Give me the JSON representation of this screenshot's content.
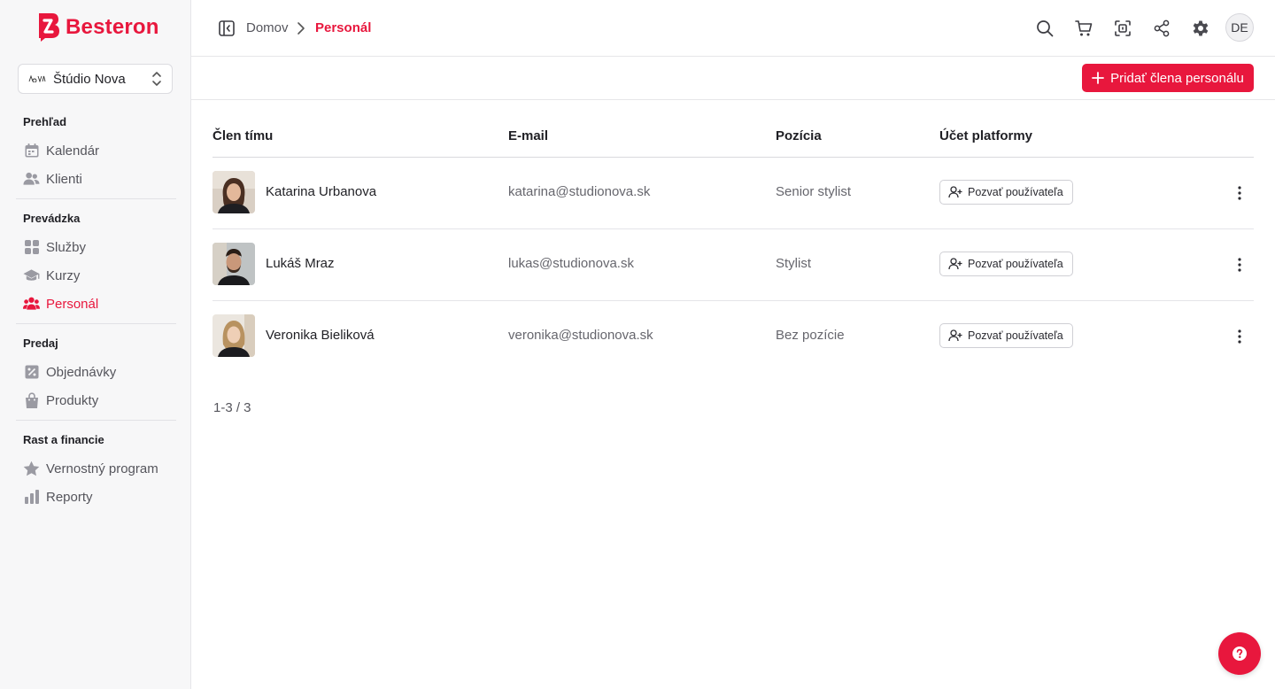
{
  "brand": {
    "name": "Besteron",
    "accent": "#e8173d"
  },
  "workspace": {
    "name": "Štúdio Nova",
    "logo_text": "NOVA"
  },
  "sidebar": {
    "sections": [
      {
        "heading": "Prehľad",
        "items": [
          {
            "label": "Kalendár",
            "icon": "calendar-icon"
          },
          {
            "label": "Klienti",
            "icon": "users-icon"
          }
        ]
      },
      {
        "heading": "Prevádzka",
        "items": [
          {
            "label": "Služby",
            "icon": "grid-icon"
          },
          {
            "label": "Kurzy",
            "icon": "graduation-cap-icon"
          },
          {
            "label": "Personál",
            "icon": "team-icon",
            "active": true
          }
        ]
      },
      {
        "heading": "Predaj",
        "items": [
          {
            "label": "Objednávky",
            "icon": "order-icon"
          },
          {
            "label": "Produkty",
            "icon": "shopping-bag-icon"
          }
        ]
      },
      {
        "heading": "Rast a financie",
        "items": [
          {
            "label": "Vernostný program",
            "icon": "star-icon"
          },
          {
            "label": "Reporty",
            "icon": "bar-chart-icon"
          }
        ]
      }
    ]
  },
  "breadcrumb": {
    "home": "Domov",
    "current": "Personál"
  },
  "topbar": {
    "user_initials": "DE"
  },
  "actions": {
    "add_staff": "Pridať člena personálu"
  },
  "table": {
    "columns": {
      "member": "Člen tímu",
      "email": "E-mail",
      "position": "Pozícia",
      "account": "Účet platformy"
    },
    "rows": [
      {
        "name": "Katarina Urbanova",
        "email": "katarina@studionova.sk",
        "position": "Senior stylist",
        "action": "Pozvať používateľa"
      },
      {
        "name": "Lukáš Mraz",
        "email": "lukas@studionova.sk",
        "position": "Stylist",
        "action": "Pozvať používateľa"
      },
      {
        "name": "Veronika Bieliková",
        "email": "veronika@studionova.sk",
        "position": "Bez pozície",
        "action": "Pozvať používateľa"
      }
    ]
  },
  "pagination": {
    "text": "1-3 / 3"
  }
}
